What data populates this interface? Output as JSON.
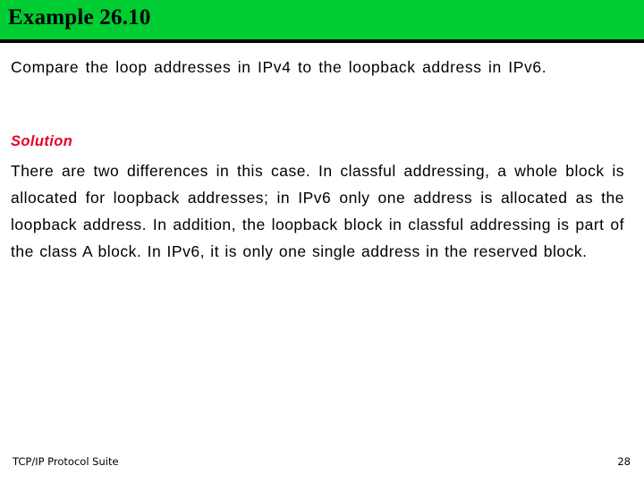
{
  "slide": {
    "title": "Example 26.10",
    "question": "Compare the loop addresses in IPv4 to the loopback address in IPv6.",
    "solution_label": "Solution",
    "solution_body": "There are two differences in this case. In classful addressing, a whole block is allocated for loopback addresses; in IPv6 only one address is allocated as the loopback address. In addition, the loopback block in classful addressing is part of the class A block. In IPv6, it is only one single address in the reserved block.",
    "footer_left": "TCP/IP Protocol Suite",
    "footer_right": "28",
    "colors": {
      "title_bar": "#00cc33",
      "title_text": "#000000",
      "solution_label": "#e8002a",
      "body_text": "#000000",
      "background": "#ffffff"
    }
  }
}
